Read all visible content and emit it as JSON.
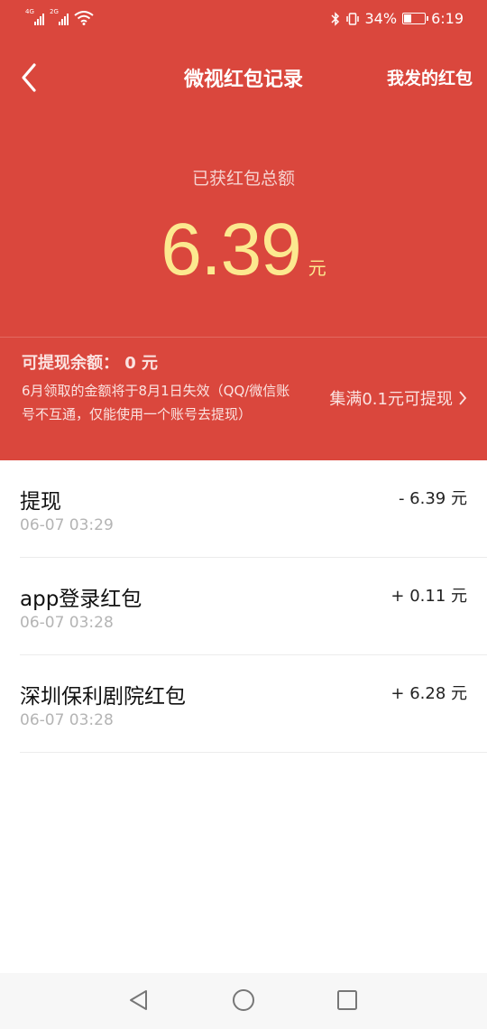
{
  "status_bar": {
    "left_sim1_tag": "4G",
    "left_sim2_tag": "2G",
    "battery_text": "34%",
    "battery_level": 0.34,
    "time": "6:19"
  },
  "nav": {
    "title": "微视红包记录",
    "right_link": "我发的红包"
  },
  "summary": {
    "label": "已获红包总额",
    "amount": "6.39",
    "unit": "元"
  },
  "withdraw": {
    "label": "可提现余额： 0 元",
    "notice": "6月领取的金额将于8月1日失效（QQ/微信账号不互通，仅能使用一个账号去提现）",
    "tip": "集满0.1元可提现"
  },
  "records": [
    {
      "title": "提现",
      "time": "06-07   03:29",
      "amount": "- 6.39 元"
    },
    {
      "title": "app登录红包",
      "time": "06-07   03:28",
      "amount": "+ 0.11 元"
    },
    {
      "title": "深圳保利剧院红包",
      "time": "06-07   03:28",
      "amount": "+ 6.28 元"
    }
  ],
  "colors": {
    "header_bg": "#da473d",
    "amount": "#fce98f"
  }
}
